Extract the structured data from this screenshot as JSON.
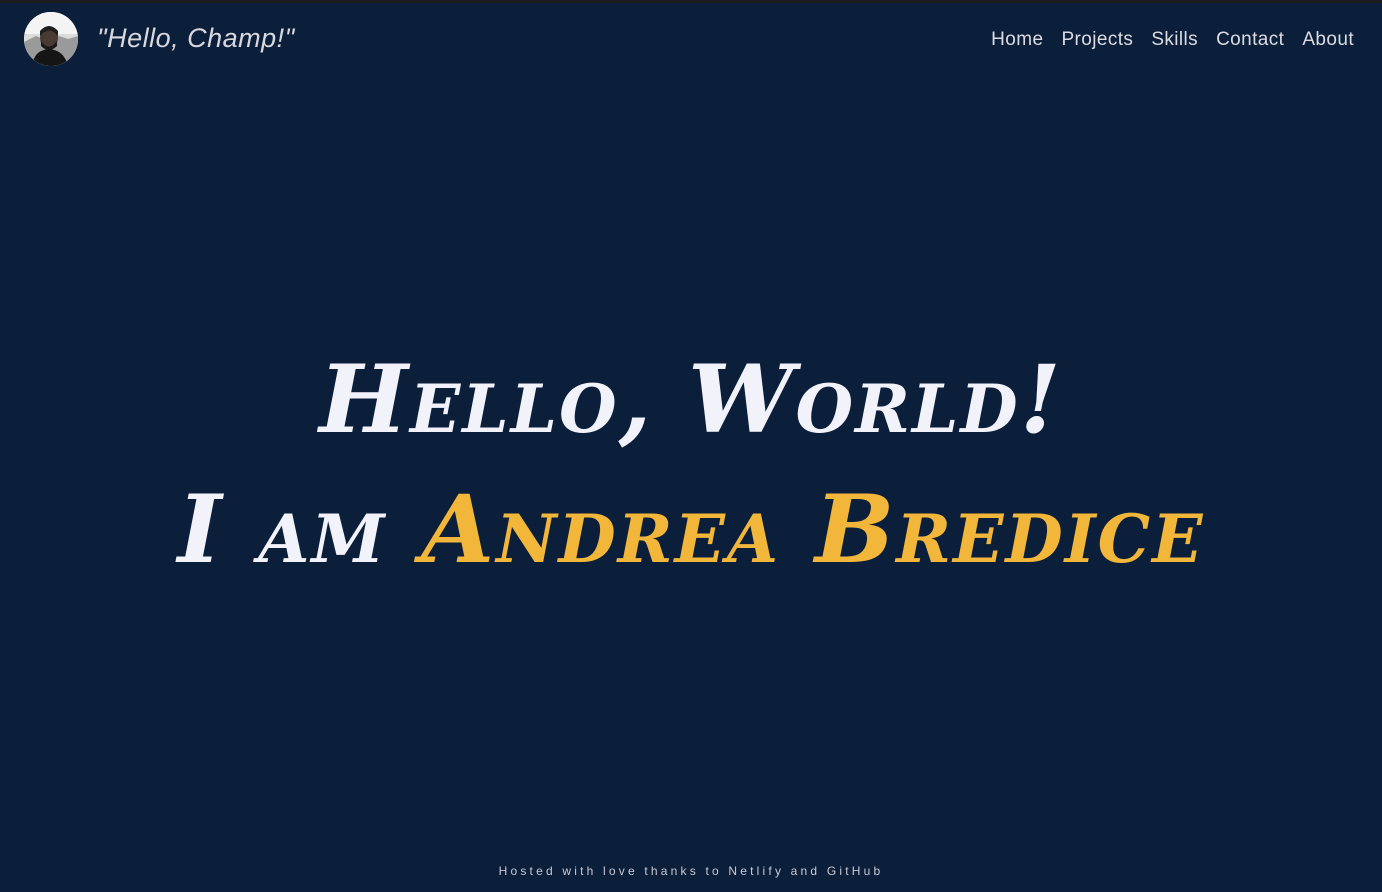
{
  "header": {
    "avatar_icon": "profile-photo-avatar",
    "greeting": "\"Hello, Champ!\"",
    "nav": [
      {
        "label": "Home"
      },
      {
        "label": "Projects"
      },
      {
        "label": "Skills"
      },
      {
        "label": "Contact"
      },
      {
        "label": "About"
      }
    ]
  },
  "hero": {
    "line1": "Hello, World!",
    "line2_prefix": "I am ",
    "name": "Andrea Bredice"
  },
  "footer": {
    "text": "Hosted with love thanks to Netlify and GitHub"
  },
  "colors": {
    "background": "#0b1f3a",
    "accent": "#f2b63b",
    "text": "#f2f2fb"
  }
}
